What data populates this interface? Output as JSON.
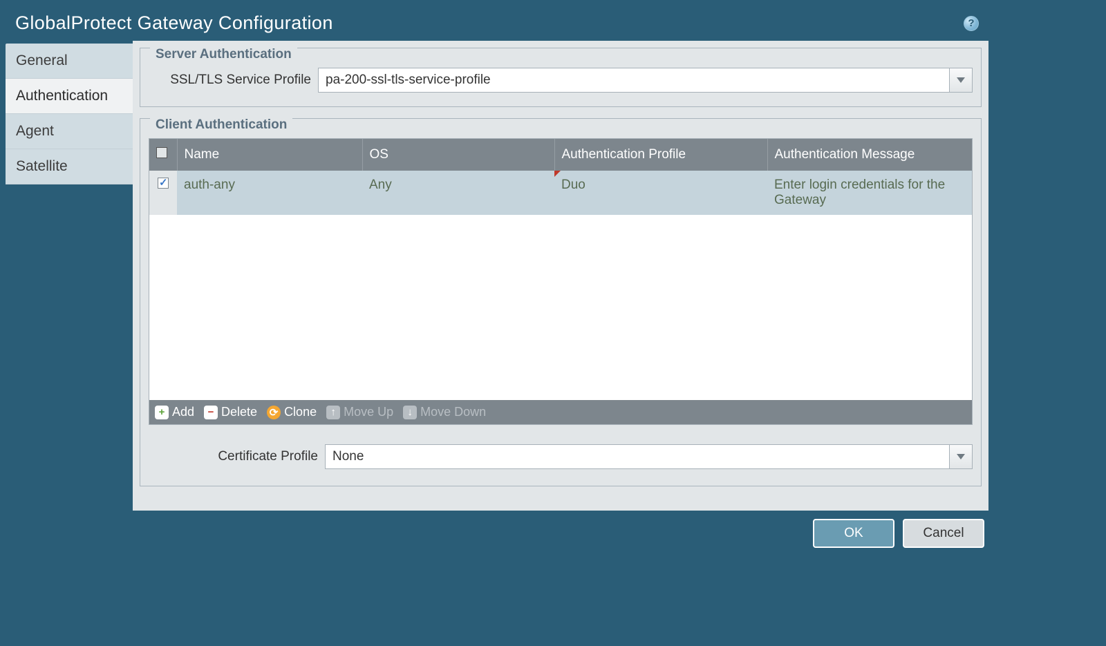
{
  "window": {
    "title": "GlobalProtect Gateway Configuration"
  },
  "tabs": {
    "general": "General",
    "authentication": "Authentication",
    "agent": "Agent",
    "satellite": "Satellite"
  },
  "server_auth": {
    "legend": "Server Authentication",
    "ssl_label": "SSL/TLS Service Profile",
    "ssl_value": "pa-200-ssl-tls-service-profile"
  },
  "client_auth": {
    "legend": "Client Authentication",
    "columns": {
      "name": "Name",
      "os": "OS",
      "auth_profile": "Authentication Profile",
      "auth_message": "Authentication Message"
    },
    "rows": [
      {
        "checked": true,
        "name": "auth-any",
        "os": "Any",
        "auth_profile": "Duo",
        "auth_message": "Enter login credentials for the Gateway"
      }
    ],
    "cert_label": "Certificate Profile",
    "cert_value": "None"
  },
  "toolbar": {
    "add": "Add",
    "delete": "Delete",
    "clone": "Clone",
    "move_up": "Move Up",
    "move_down": "Move Down"
  },
  "buttons": {
    "ok": "OK",
    "cancel": "Cancel"
  }
}
